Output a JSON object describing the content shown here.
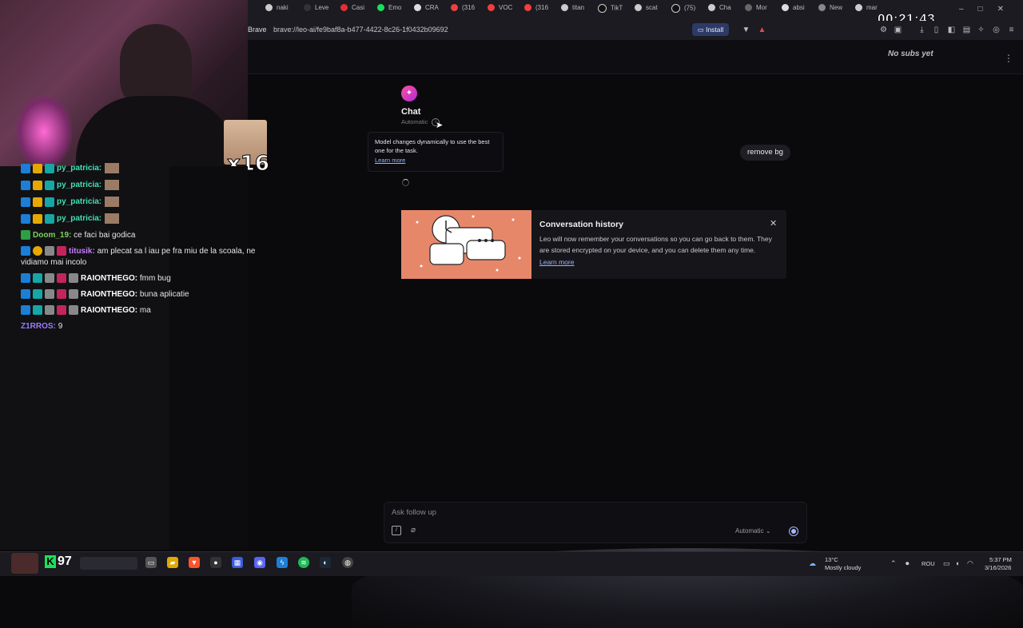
{
  "overlay": {
    "timer": "00:21:43",
    "cat_multiplier": "x16",
    "taskbar_score": "97",
    "taskbar_score_icon": "K"
  },
  "chat": {
    "messages": [
      {
        "user": "py_patricia:",
        "text": "",
        "user_color": "#41e0b5"
      },
      {
        "user": "py_patricia:",
        "text": "",
        "user_color": "#41e0b5"
      },
      {
        "user": "py_patricia:",
        "text": "",
        "user_color": "#41e0b5"
      },
      {
        "user": "py_patricia:",
        "text": "",
        "user_color": "#41e0b5"
      },
      {
        "user": "Doom_19:",
        "text": "ce faci bai godica",
        "user_color": "#7cd35a"
      },
      {
        "user": "titusik:",
        "text": "am plecat sa l iau pe fra miu de la scoala, ne",
        "user_color": "#c77dff"
      },
      {
        "user": "",
        "text": "vidiamo mai incolo",
        "user_color": "#ffffff"
      },
      {
        "user": "RAIONTHEGO:",
        "text": "fmm bug",
        "user_color": "#ffffff"
      },
      {
        "user": "RAIONTHEGO:",
        "text": "buna aplicatie",
        "user_color": "#ffffff"
      },
      {
        "user": "RAIONTHEGO:",
        "text": "ma",
        "user_color": "#ffffff"
      },
      {
        "user": "Z1RROS:",
        "text": "9",
        "user_color": "#9b7bff"
      }
    ]
  },
  "browser": {
    "tabs": [
      "naki",
      "Leve",
      "Casi",
      "Emo",
      "CRA",
      "(316",
      "VOC",
      "(316",
      "titan",
      "TikT",
      "scat",
      "(75)",
      "Cha",
      "Mor",
      "absi",
      "New",
      "mar"
    ],
    "brand": "Brave",
    "url": "brave://leo-ai/fe9baf8a-b477-4422-8c26-1f0432b09692",
    "install_label": "Install"
  },
  "leo": {
    "header_status": "No subs yet",
    "chat_title": "Chat",
    "chat_mode": "Automatic",
    "tooltip_text": "Model changes dynamically to use the best one for the task.",
    "tooltip_link": "Learn more",
    "user_message": "remove bg",
    "history_card": {
      "title": "Conversation history",
      "body": "Leo will now remember your conversations so you can go back to them. They are stored encrypted on your device, and you can delete them any time.",
      "link": "Learn more",
      "accent_color": "#e7876a"
    },
    "composer": {
      "placeholder": "Ask follow up",
      "model_label": "Automatic"
    }
  },
  "taskbar": {
    "weather_temp": "13°C",
    "weather_desc": "Mostly cloudy",
    "lang": "ROU",
    "time": "5:37 PM",
    "date": "3/16/2026"
  }
}
